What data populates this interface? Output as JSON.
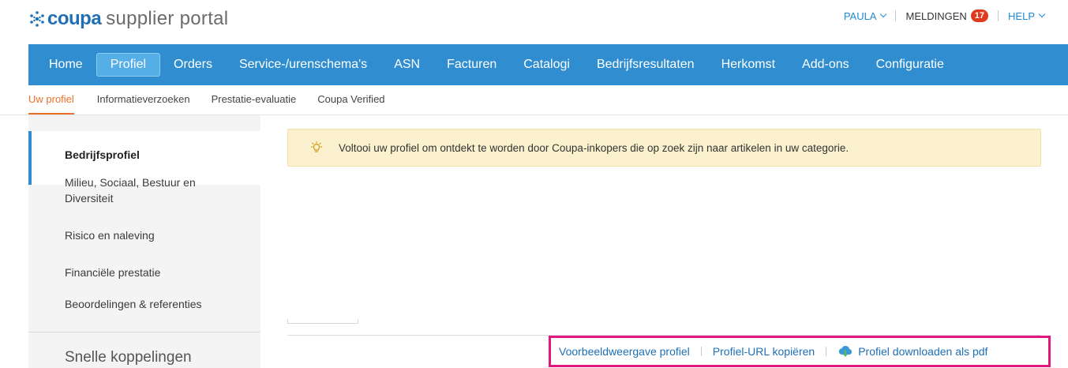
{
  "brand": {
    "name": "coupa",
    "suffix": "supplier portal",
    "color": "#1f6fb5",
    "logo_icon": "coupa-snowflake-icon"
  },
  "user_nav": {
    "user": "PAULA",
    "notifications_label": "MELDINGEN",
    "notifications_count": "17",
    "help": "HELP"
  },
  "main_nav": {
    "items": [
      {
        "label": "Home"
      },
      {
        "label": "Profiel"
      },
      {
        "label": "Orders"
      },
      {
        "label": "Service-/urenschema's"
      },
      {
        "label": "ASN"
      },
      {
        "label": "Facturen"
      },
      {
        "label": "Catalogi"
      },
      {
        "label": "Bedrijfsresultaten"
      },
      {
        "label": "Herkomst"
      },
      {
        "label": "Add-ons"
      },
      {
        "label": "Configuratie"
      }
    ],
    "active": "Profiel",
    "background": "#2f8dd0"
  },
  "sub_nav": {
    "items": [
      {
        "label": "Uw profiel"
      },
      {
        "label": "Informatieverzoeken"
      },
      {
        "label": "Prestatie-evaluatie"
      },
      {
        "label": "Coupa Verified"
      }
    ],
    "active": "Uw profiel",
    "accent": "#e8702a"
  },
  "sidebar": {
    "items": [
      {
        "label": "Bedrijfsprofiel"
      },
      {
        "label": "Milieu, Sociaal, Bestuur en Diversiteit"
      },
      {
        "label": "Risico en naleving"
      },
      {
        "label": "Financiële prestatie"
      },
      {
        "label": "Beoordelingen & referenties"
      }
    ],
    "active": "Bedrijfsprofiel",
    "quick_links_heading": "Snelle koppelingen"
  },
  "banner": {
    "icon": "lightbulb-icon",
    "text": "Voltooi uw profiel om ontdekt te worden door Coupa-inkopers die op zoek zijn naar artikelen in uw categorie."
  },
  "actions": {
    "preview": "Voorbeeldweergave profiel",
    "copy_url": "Profiel-URL kopiëren",
    "download_pdf": "Profiel downloaden als pdf",
    "download_icon": "cloud-download-icon",
    "highlight_color": "#e0197e"
  }
}
